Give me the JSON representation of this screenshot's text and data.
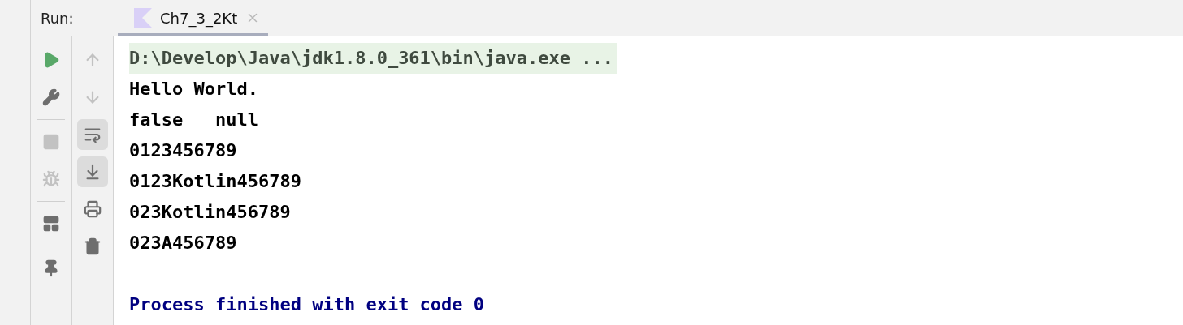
{
  "run_bar": {
    "label": "Run:",
    "tab": {
      "title": "Ch7_3_2Kt",
      "selected": true
    }
  },
  "left_toolbar": [
    {
      "kind": "rerun",
      "disabled": false
    },
    {
      "kind": "settings",
      "disabled": false
    },
    {
      "kind": "separator"
    },
    {
      "kind": "stop",
      "disabled": true
    },
    {
      "kind": "debug",
      "disabled": true
    },
    {
      "kind": "separator"
    },
    {
      "kind": "layout",
      "disabled": false
    },
    {
      "kind": "separator"
    },
    {
      "kind": "pin",
      "disabled": false
    }
  ],
  "right_toolbar": [
    {
      "kind": "up",
      "disabled": true,
      "selected": false
    },
    {
      "kind": "down",
      "disabled": true,
      "selected": false
    },
    {
      "kind": "wrap",
      "disabled": false,
      "selected": true
    },
    {
      "kind": "scroll_end",
      "disabled": false,
      "selected": true
    },
    {
      "kind": "print",
      "disabled": false,
      "selected": false
    },
    {
      "kind": "trash",
      "disabled": false,
      "selected": false
    }
  ],
  "console": [
    {
      "kind": "command",
      "text": "D:\\Develop\\Java\\jdk1.8.0_361\\bin\\java.exe ..."
    },
    {
      "kind": "output",
      "text": "Hello World."
    },
    {
      "kind": "output",
      "text": "false   null"
    },
    {
      "kind": "output",
      "text": "0123456789"
    },
    {
      "kind": "output",
      "text": "0123Kotlin456789"
    },
    {
      "kind": "output",
      "text": "023Kotlin456789"
    },
    {
      "kind": "output",
      "text": "023A456789"
    },
    {
      "kind": "blank"
    },
    {
      "kind": "exit",
      "text": "Process finished with exit code 0"
    }
  ]
}
